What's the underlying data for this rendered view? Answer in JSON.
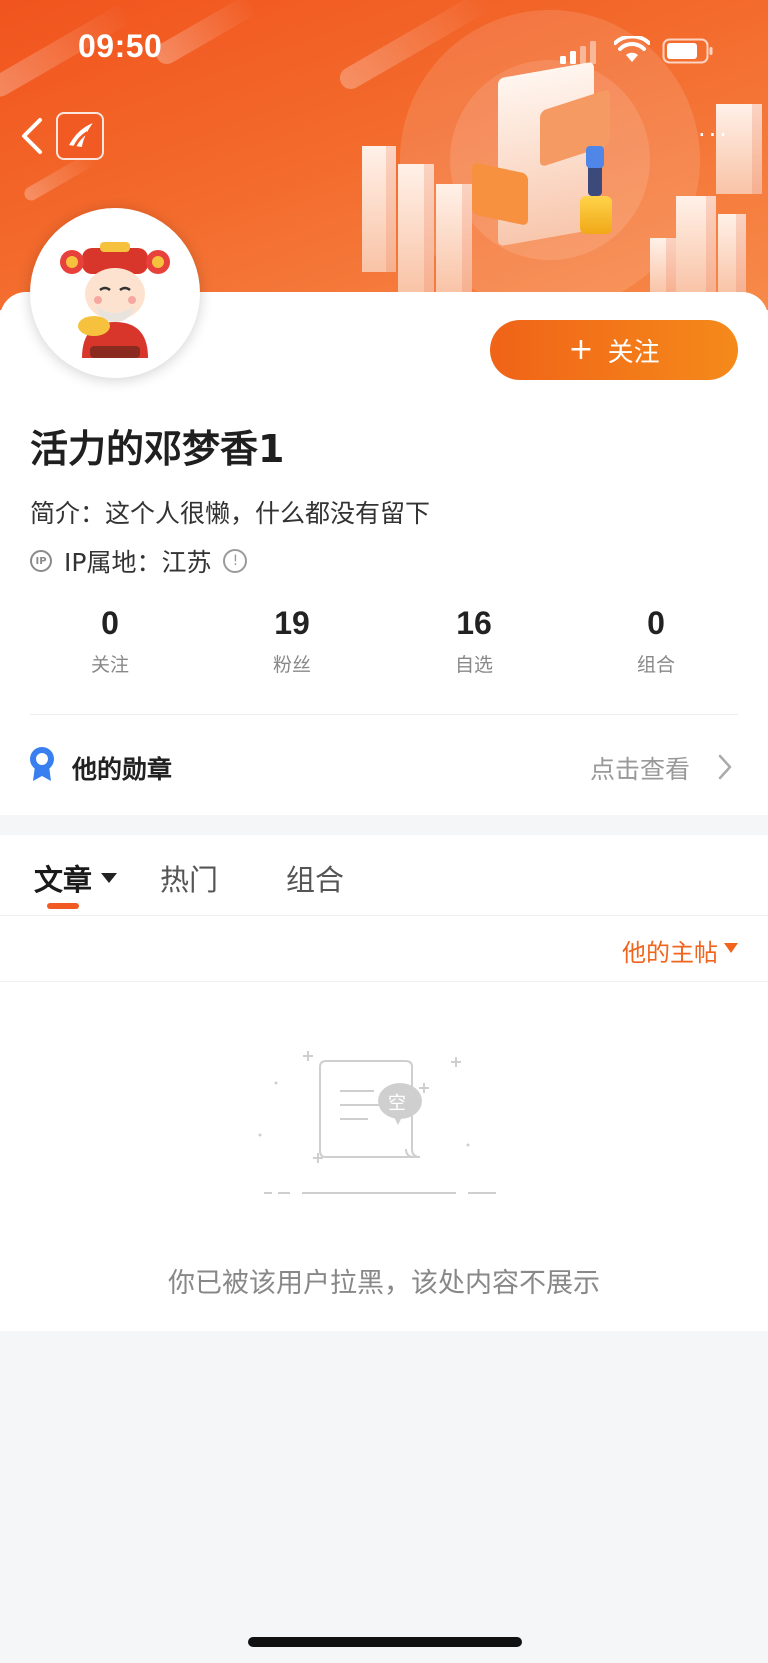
{
  "status_bar": {
    "time": "09:50"
  },
  "profile": {
    "name": "活力的邓梦香1",
    "bio": "简介：这个人很懒，什么都没有留下",
    "ip_location": "IP属地：江苏",
    "ip_badge": "IP",
    "follow_button": "关注",
    "follow_plus": "+",
    "more_icon": "···"
  },
  "stats": [
    {
      "value": "0",
      "label": "关注"
    },
    {
      "value": "19",
      "label": "粉丝"
    },
    {
      "value": "16",
      "label": "自选"
    },
    {
      "value": "0",
      "label": "组合"
    }
  ],
  "medals": {
    "title": "他的勋章",
    "link": "点击查看"
  },
  "tabs": [
    {
      "label": "文章",
      "active": true
    },
    {
      "label": "热门",
      "active": false
    },
    {
      "label": "组合",
      "active": false
    }
  ],
  "filter": {
    "label": "他的主帖"
  },
  "empty": {
    "badge": "空",
    "message": "你已被该用户拉黑，该处内容不展示"
  },
  "colors": {
    "accent": "#f15a22",
    "follow_gradient_start": "#f06318",
    "follow_gradient_end": "#f58a1a",
    "medal_blue": "#3a7ff0"
  },
  "icons": [
    "back-icon",
    "app-logo-icon",
    "more-icon",
    "ip-icon",
    "info-icon",
    "medal-icon",
    "chevron-right-icon",
    "signal-icon",
    "wifi-icon",
    "battery-icon"
  ]
}
